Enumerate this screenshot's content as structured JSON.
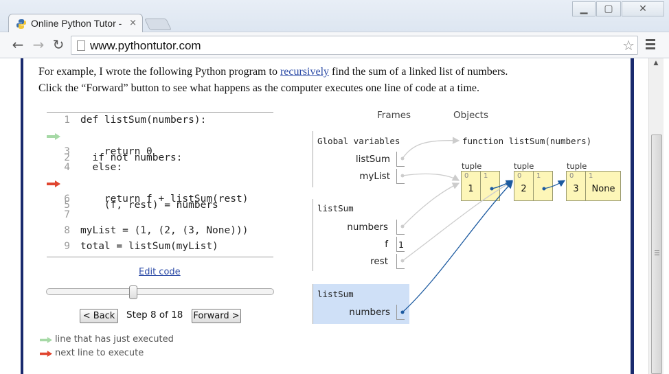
{
  "browser": {
    "tab_title": "Online Python Tutor - ",
    "tab_close": "×",
    "url": "www.pythontutor.com",
    "window_buttons": {
      "minimize": "▁",
      "maximize": "▢",
      "close": "✕"
    },
    "nav": {
      "back": "←",
      "forward": "→",
      "reload": "↻"
    },
    "star": "☆"
  },
  "intro": {
    "line1_before": "For example, I wrote the following Python program to ",
    "line1_link": "recursively",
    "line1_after": " find the sum of a linked list of numbers.",
    "line2": "Click the “Forward” button to see what happens as the computer executes one line of code at a time."
  },
  "code": {
    "lines": [
      {
        "num": "1",
        "text": "def listSum(numbers):"
      },
      {
        "num": "2",
        "text": "  if not numbers:"
      },
      {
        "num": "3",
        "text": "    return 0"
      },
      {
        "num": "4",
        "text": "  else:"
      },
      {
        "num": "5",
        "text": "    (f, rest) = numbers"
      },
      {
        "num": "6",
        "text": "    return f + listSum(rest)"
      },
      {
        "num": "7",
        "text": ""
      },
      {
        "num": "8",
        "text": "myList = (1, (2, (3, None)))"
      },
      {
        "num": "9",
        "text": "total = listSum(myList)"
      }
    ],
    "just_executed_line": "2",
    "next_line": "5",
    "just_executed_color": "#a6d9a6",
    "next_line_color": "#e0452f"
  },
  "controls": {
    "edit_code": "Edit code",
    "back": "< Back",
    "step_text": "Step 8 of 18",
    "forward": "Forward >",
    "step_current": 8,
    "step_total": 18
  },
  "legend": {
    "executed": "line that has just executed",
    "next": "next line to execute"
  },
  "viz": {
    "frames_header": "Frames",
    "objects_header": "Objects",
    "global_title": "Global variables",
    "global_vars": [
      "listSum",
      "myList"
    ],
    "frame1_title": "listSum",
    "frame1_vars": {
      "numbers": "numbers",
      "f": "f",
      "f_value": "1",
      "rest": "rest"
    },
    "frame2_title": "listSum",
    "frame2_vars": {
      "numbers": "numbers"
    },
    "function_obj": "function listSum(numbers)",
    "tuples": [
      {
        "label": "tuple",
        "cells": [
          {
            "index": "0",
            "value": "1"
          },
          {
            "index": "1",
            "value": ""
          }
        ]
      },
      {
        "label": "tuple",
        "cells": [
          {
            "index": "0",
            "value": "2"
          },
          {
            "index": "1",
            "value": ""
          }
        ]
      },
      {
        "label": "tuple",
        "cells": [
          {
            "index": "0",
            "value": "3"
          },
          {
            "index": "1",
            "value": "None"
          }
        ]
      }
    ],
    "active_frame_color": "#cfe0f7",
    "tuple_color": "#fdf6b8",
    "active_arrow_color": "#1c5aa0",
    "inactive_arrow_color": "#cccccc"
  }
}
